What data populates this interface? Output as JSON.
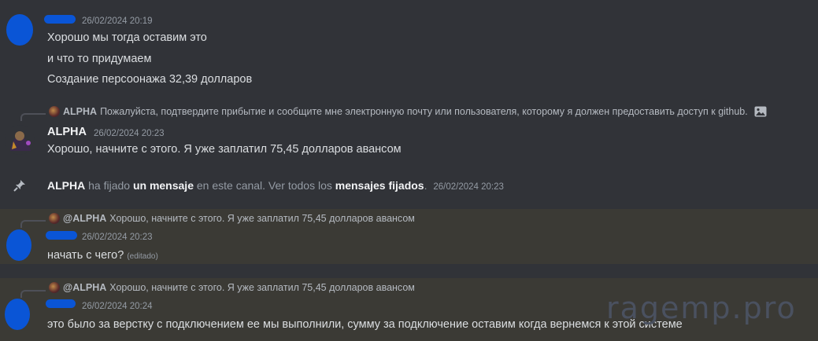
{
  "messages": {
    "m1": {
      "timestamp": "26/02/2024 20:19",
      "lines": [
        "Хорошо мы тогда оставим это",
        "и что то придумаем",
        "Создание персоонажа 32,39 долларов"
      ]
    },
    "m2": {
      "reply_author": "ALPHA",
      "reply_text": "Пожалуйста, подтвердите прибытие и сообщите мне электронную почту или пользователя, которому я должен предоставить доступ к github.",
      "author": "ALPHA",
      "timestamp": "26/02/2024 20:23",
      "text": "Хорошо, начните с этого. Я уже заплатил 75,45 долларов авансом"
    },
    "pin": {
      "author": "ALPHA",
      "t1": " ha fijado ",
      "link1": "un mensaje",
      "t2": " en este canal. Ver todos los ",
      "link2": "mensajes fijados",
      "t3": ".",
      "timestamp": "26/02/2024 20:23"
    },
    "m3": {
      "reply_author": "@ALPHA",
      "reply_text": "Хорошо, начните с этого. Я уже заплатил 75,45 долларов авансом",
      "timestamp": "26/02/2024 20:23",
      "text": "начать с чего?",
      "edited": "(editado)"
    },
    "m4": {
      "reply_author": "@ALPHA",
      "reply_text": "Хорошо, начните с этого. Я уже заплатил 75,45 долларов авансом",
      "timestamp": "26/02/2024 20:24",
      "text": "это было за верстку с подключением ее мы выполнили, сумму за подключение оставим когда вернемся к этой системе"
    }
  },
  "watermark": "ragemp.pro",
  "icons": {
    "pin": "pin-icon",
    "image": "image-icon"
  }
}
